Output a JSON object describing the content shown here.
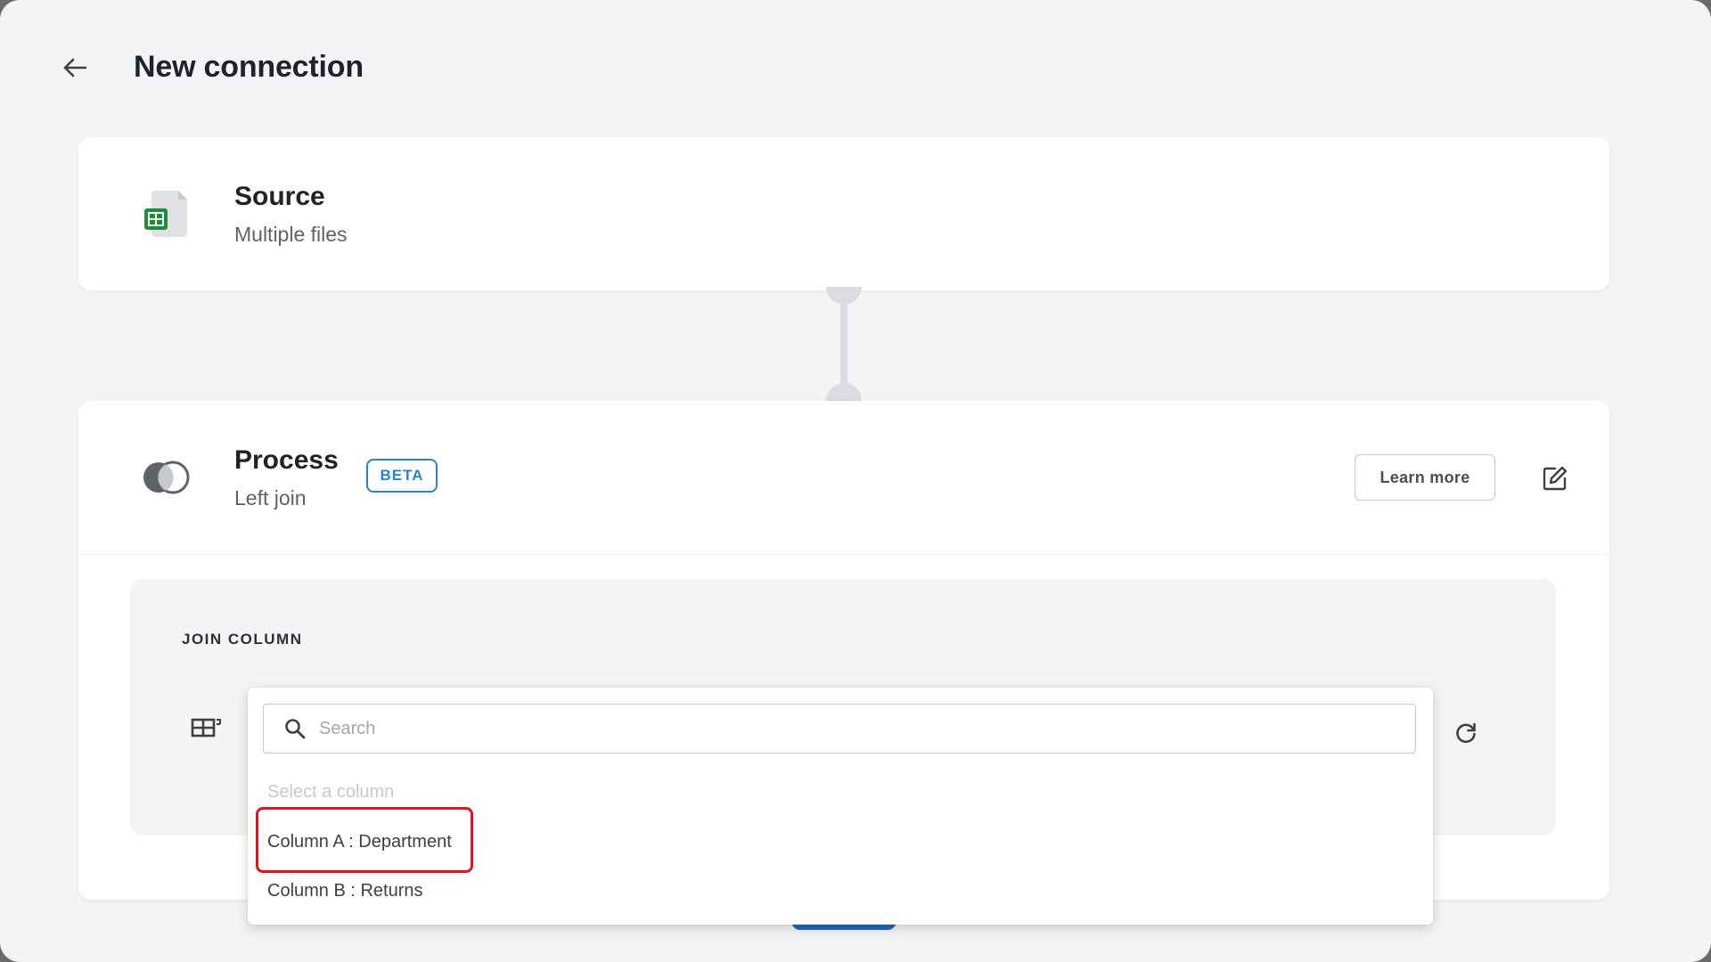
{
  "header": {
    "back_icon": "arrow-left-icon",
    "title": "New connection"
  },
  "source": {
    "icon": "spreadsheet-file-icon",
    "title": "Source",
    "subtitle": "Multiple files"
  },
  "process": {
    "icon": "join-circles-icon",
    "title": "Process",
    "subtitle": "Left join",
    "badge": "BETA",
    "learn_more_label": "Learn more",
    "edit_icon": "edit-icon"
  },
  "join": {
    "label": "JOIN COLUMN",
    "table_icon": "table-icon",
    "refresh_icon": "refresh-icon"
  },
  "dropdown": {
    "search_placeholder": "Search",
    "search_value": "",
    "hint": "Select a column",
    "options": [
      {
        "label": "Column A : Department",
        "highlighted": true
      },
      {
        "label": "Column B : Returns",
        "highlighted": false
      }
    ]
  },
  "colors": {
    "accent": "#2b7fd6",
    "highlight": "#e0141e",
    "sheets_green": "#1e8e3e"
  }
}
